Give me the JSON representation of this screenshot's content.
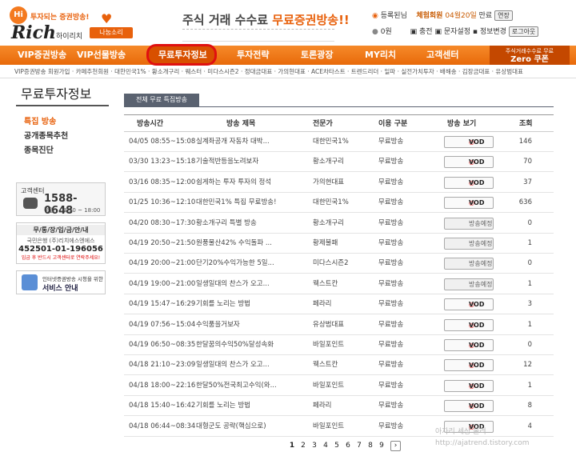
{
  "brand": {
    "hi": "Hi",
    "tagline": "투자되는 증권방송!",
    "name": "Rich",
    "name_kr": "하이리치",
    "share_label": "나눔소리",
    "accent": "#e8610c"
  },
  "banner": {
    "prefix": "주식 거래 수수료 ",
    "highlight": "무료증권방송!!"
  },
  "user": {
    "grade_label": "등록된님",
    "member_type": "체험회원",
    "expiry": "04월20일",
    "expiry_suffix": "만료",
    "extend": "연장",
    "balance": "0원",
    "charge": "충전",
    "sms": "문자설정",
    "info": "정보변경",
    "logout": "로그아웃"
  },
  "nav": {
    "items": [
      "VIP증권방송",
      "VIP선물방송",
      "무료투자정보",
      "투자전략",
      "토론광장",
      "MY리치",
      "고객센터"
    ],
    "coupon_small": "주식거래수수료 무료",
    "coupon_big": "Zero 쿠폰"
  },
  "subnav": "VIP증권방송 회원가입 · 카페추천회원 · 대한민국1% · 황소개구리 · 웨스터 · 미다스시즌2 · 정대금대표 · 가의현대표 · ACE차타스트 · 트렌드리더 · 일파 · 실전가치투자 · 배해송 · 김장금대표 · 유상범대표",
  "sidebar": {
    "title": "무료투자정보",
    "menu": [
      "특집 방송",
      "공개종목추천",
      "종목진단"
    ]
  },
  "support": {
    "label": "고객센터",
    "phone": "1588-0648",
    "hours": "평일 : 08:30 ~ 18:00"
  },
  "account": {
    "header": "무/통/장/입/금/안/내",
    "bank": "국민은행 (주)리치에스엔에스",
    "number": "452501-01-196056",
    "note": "입금 후 반드시 고객센터로 연락주세요!"
  },
  "guide": {
    "small": "인터넷증권방송 시청을 위한",
    "big": "서비스 안내"
  },
  "section_tab": "전체 무료 특집방송",
  "table": {
    "headers": [
      "방송시간",
      "방송 제목",
      "전문가",
      "이용 구분",
      "방송 보기",
      "조회"
    ],
    "rows": [
      {
        "time": "04/05 08:55~15:08",
        "title": "실계좌공개 자동차 대박...",
        "expert": "대한민국1%",
        "type": "무료방송",
        "action": "VOD",
        "views": "146"
      },
      {
        "time": "03/30 13:23~15:18",
        "title": "기술적반등을노려보자",
        "expert": "황소개구리",
        "type": "무료방송",
        "action": "VOD",
        "views": "70"
      },
      {
        "time": "03/16 08:35~12:00",
        "title": "쉽게하는 투자 투자의 정석",
        "expert": "가의현대표",
        "type": "무료방송",
        "action": "VOD",
        "views": "37"
      },
      {
        "time": "01/25 10:36~12:10",
        "title": "대한민국1% 특집 무료방송!",
        "expert": "대한민국1%",
        "type": "무료방송",
        "action": "VOD",
        "views": "636"
      },
      {
        "time": "04/20 08:30~17:30",
        "title": "황소개구리 특별 방송",
        "expert": "황소개구리",
        "type": "무료방송",
        "action": "방송예정",
        "views": "0"
      },
      {
        "time": "04/19 20:50~21:50",
        "title": "원풍물산42% 수익돌파 ...",
        "expert": "황제불패",
        "type": "무료방송",
        "action": "방송예정",
        "views": "1"
      },
      {
        "time": "04/19 20:00~21:00",
        "title": "단기20%수익가능한 5일...",
        "expert": "미다스시즌2",
        "type": "무료방송",
        "action": "방송예정",
        "views": "0"
      },
      {
        "time": "04/19 19:00~21:00",
        "title": "일생일대의 찬스가 오고...",
        "expert": "웩스트칸",
        "type": "무료방송",
        "action": "방송예정",
        "views": "1"
      },
      {
        "time": "04/19 15:47~16:29",
        "title": "기회를 노리는 방법",
        "expert": "페라리",
        "type": "무료방송",
        "action": "VOD",
        "views": "3"
      },
      {
        "time": "04/19 07:56~15:04",
        "title": "수익품을거보자",
        "expert": "유상범대표",
        "type": "무료방송",
        "action": "VOD",
        "views": "1"
      },
      {
        "time": "04/19 06:50~08:35",
        "title": "한달꿈의수익50%달성속화",
        "expert": "바일포인트",
        "type": "무료방송",
        "action": "VOD",
        "views": "0"
      },
      {
        "time": "04/18 21:10~23:09",
        "title": "일생일대의 찬스가 오고...",
        "expert": "웩스트칸",
        "type": "무료방송",
        "action": "VOD",
        "views": "12"
      },
      {
        "time": "04/18 18:00~22:16",
        "title": "한달50%전국최고수익(와...",
        "expert": "바일포인트",
        "type": "무료방송",
        "action": "VOD",
        "views": "1"
      },
      {
        "time": "04/18 15:40~16:42",
        "title": "기회를 노리는 방법",
        "expert": "페라리",
        "type": "무료방송",
        "action": "VOD",
        "views": "8"
      },
      {
        "time": "04/18 06:44~08:34",
        "title": "대형군도 공략(핵심으로)",
        "expert": "바일포인트",
        "type": "무료방송",
        "action": "VOD",
        "views": "4"
      }
    ]
  },
  "pager": {
    "pages": [
      "1",
      "2",
      "3",
      "4",
      "5",
      "6",
      "7",
      "8",
      "9"
    ],
    "current": "1",
    "next": "›"
  },
  "watermark": {
    "line1": "아자리 세상 올려",
    "line2": "http://ajatrend.tistory.com"
  }
}
